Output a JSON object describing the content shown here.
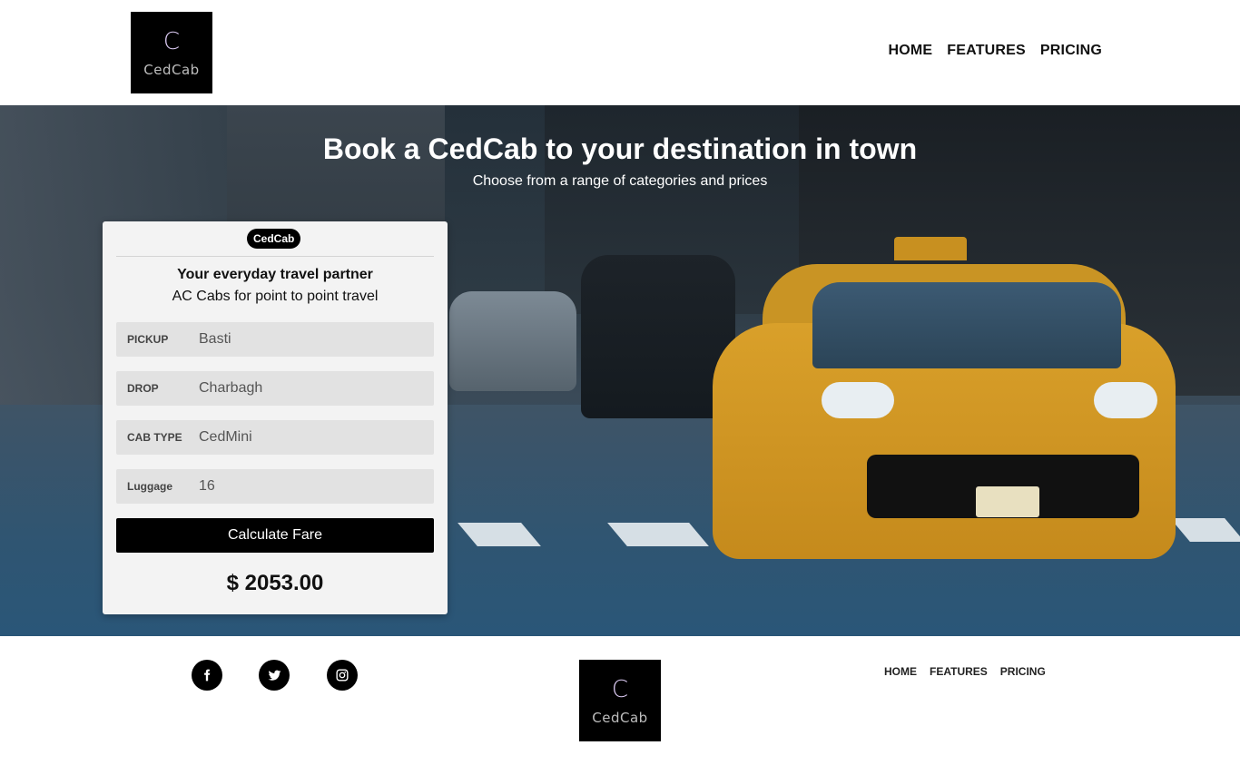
{
  "brand": {
    "logo_letter": "C",
    "logo_word": "CedCab"
  },
  "nav": {
    "items": [
      {
        "label": "HOME"
      },
      {
        "label": "FEATURES"
      },
      {
        "label": "PRICING"
      }
    ]
  },
  "hero": {
    "title": "Book a CedCab to your destination in town",
    "subtitle": "Choose from a range of categories and prices"
  },
  "booking": {
    "badge": "CedCab",
    "tagline": "Your everyday travel partner",
    "tagline_sub": "AC Cabs for point to point travel",
    "fields": [
      {
        "label": "PICKUP",
        "value": "Basti"
      },
      {
        "label": "DROP",
        "value": "Charbagh"
      },
      {
        "label": "CAB TYPE",
        "value": "CedMini"
      },
      {
        "label": "Luggage",
        "value": "16"
      }
    ],
    "calculate_label": "Calculate Fare",
    "fare": "$ 2053.00"
  },
  "footer": {
    "social": [
      {
        "icon": "facebook-icon"
      },
      {
        "icon": "twitter-icon"
      },
      {
        "icon": "instagram-icon"
      }
    ],
    "nav": [
      {
        "label": "HOME"
      },
      {
        "label": "FEATURES"
      },
      {
        "label": "PRICING"
      }
    ]
  }
}
